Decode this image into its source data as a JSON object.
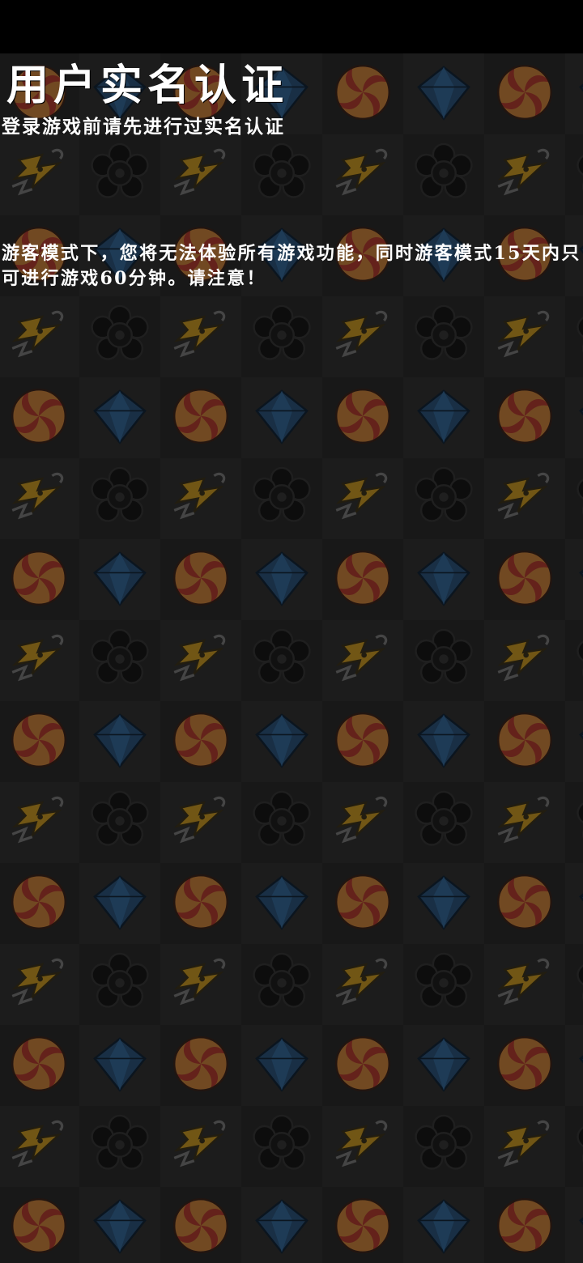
{
  "auth_screen": {
    "title": "用户实名认证",
    "subtitle": "登录游戏前请先进行过实名认证",
    "notice": "游客模式下，您将无法体验所有游戏功能，同时游客模式15天内只可进行游戏60分钟。请注意！"
  },
  "background": {
    "tile_icons": [
      "swirl-candy-icon",
      "blue-diamond-icon",
      "lightning-dragon-icon",
      "black-flower-icon"
    ],
    "colors": {
      "status_bar": "#000000",
      "page": "#1b1b1b",
      "text": "#ffffff",
      "candy_red": "#7a2a22",
      "candy_orange": "#8a5a2a",
      "diamond_blue": "#1f3a55",
      "dragon_yellow": "#8a6a1a",
      "flower_black": "#101010"
    }
  }
}
